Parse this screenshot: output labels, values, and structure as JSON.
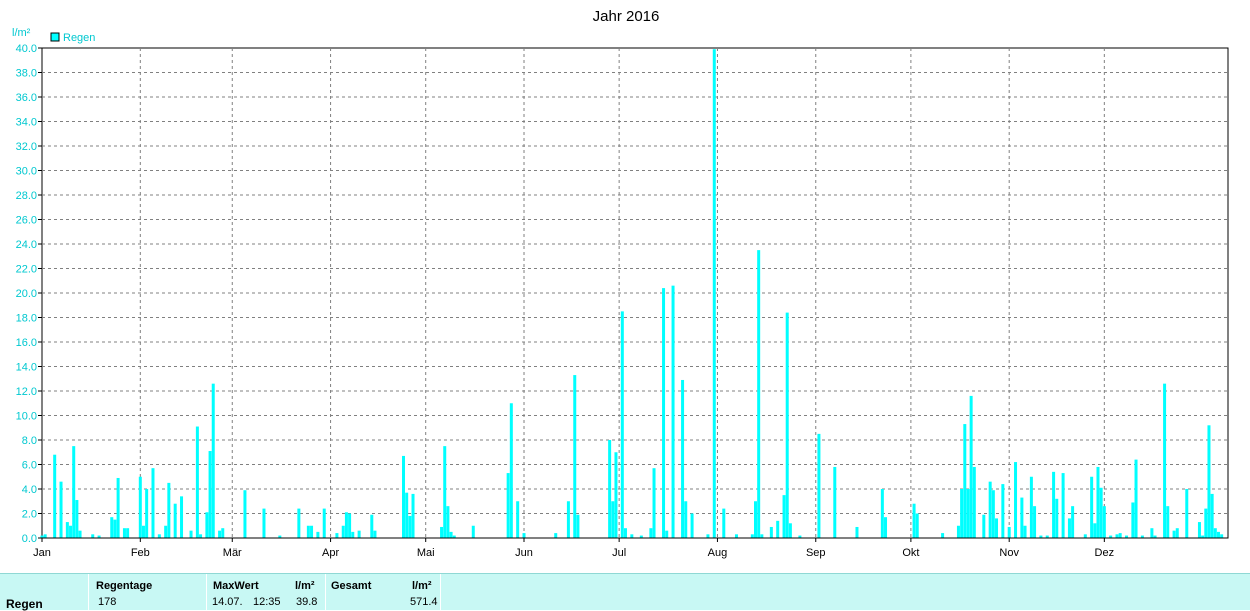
{
  "chart_data": {
    "type": "bar",
    "title": "Jahr 2016",
    "ylabel": "l/m²",
    "ylim": [
      0,
      40
    ],
    "ytick_labels": [
      "0.0",
      "2.0",
      "4.0",
      "6.0",
      "8.0",
      "10.0",
      "12.0",
      "14.0",
      "16.0",
      "18.0",
      "20.0",
      "22.0",
      "24.0",
      "26.0",
      "28.0",
      "30.0",
      "32.0",
      "34.0",
      "36.0",
      "38.0",
      "40.0"
    ],
    "x_tick_labels": [
      "Jan",
      "Feb",
      "Mär",
      "Apr",
      "Mai",
      "Jun",
      "Jul",
      "Aug",
      "Sep",
      "Okt",
      "Nov",
      "Dez"
    ],
    "grid": true,
    "legend": {
      "position": "top-left",
      "entries": [
        "Regen"
      ]
    },
    "color": "#00ffff",
    "series": [
      {
        "name": "Regen",
        "points": [
          [
            1,
            0.2
          ],
          [
            2,
            0.3
          ],
          [
            5,
            6.8
          ],
          [
            7,
            4.6
          ],
          [
            9,
            1.3
          ],
          [
            10,
            1.0
          ],
          [
            11,
            7.5
          ],
          [
            12,
            3.1
          ],
          [
            13,
            0.6
          ],
          [
            17,
            0.3
          ],
          [
            19,
            0.2
          ],
          [
            23,
            1.7
          ],
          [
            24,
            1.5
          ],
          [
            25,
            4.9
          ],
          [
            27,
            0.8
          ],
          [
            28,
            0.8
          ],
          [
            32,
            5.0
          ],
          [
            33,
            1.0
          ],
          [
            34,
            4.0
          ],
          [
            36,
            5.7
          ],
          [
            38,
            0.3
          ],
          [
            40,
            1.0
          ],
          [
            41,
            4.5
          ],
          [
            43,
            2.8
          ],
          [
            45,
            3.4
          ],
          [
            48,
            0.6
          ],
          [
            50,
            9.1
          ],
          [
            51,
            0.3
          ],
          [
            53,
            2.1
          ],
          [
            54,
            7.1
          ],
          [
            55,
            12.6
          ],
          [
            57,
            0.6
          ],
          [
            58,
            0.8
          ],
          [
            65,
            3.9
          ],
          [
            71,
            2.4
          ],
          [
            76,
            0.2
          ],
          [
            82,
            2.4
          ],
          [
            85,
            1.0
          ],
          [
            86,
            1.0
          ],
          [
            88,
            0.5
          ],
          [
            90,
            2.4
          ],
          [
            94,
            0.4
          ],
          [
            96,
            1.0
          ],
          [
            97,
            2.1
          ],
          [
            98,
            2.0
          ],
          [
            99,
            0.5
          ],
          [
            101,
            0.6
          ],
          [
            105,
            1.9
          ],
          [
            106,
            0.6
          ],
          [
            115,
            6.7
          ],
          [
            116,
            3.7
          ],
          [
            117,
            1.8
          ],
          [
            118,
            3.6
          ],
          [
            127,
            0.9
          ],
          [
            128,
            7.5
          ],
          [
            129,
            2.6
          ],
          [
            130,
            0.5
          ],
          [
            131,
            0.2
          ],
          [
            137,
            1.0
          ],
          [
            148,
            5.3
          ],
          [
            149,
            11.0
          ],
          [
            151,
            3.0
          ],
          [
            153,
            0.4
          ],
          [
            163,
            0.4
          ],
          [
            167,
            3.0
          ],
          [
            169,
            13.3
          ],
          [
            170,
            1.9
          ],
          [
            180,
            8.0
          ],
          [
            181,
            3.0
          ],
          [
            182,
            7.0
          ],
          [
            184,
            18.5
          ],
          [
            185,
            0.8
          ],
          [
            187,
            0.3
          ],
          [
            190,
            0.2
          ],
          [
            193,
            0.8
          ],
          [
            194,
            5.7
          ],
          [
            197,
            20.4
          ],
          [
            198,
            0.6
          ],
          [
            200,
            20.6
          ],
          [
            203,
            12.9
          ],
          [
            204,
            3.0
          ],
          [
            206,
            2.0
          ],
          [
            211,
            0.3
          ],
          [
            213,
            39.9
          ],
          [
            216,
            2.4
          ],
          [
            220,
            0.3
          ],
          [
            225,
            0.3
          ],
          [
            226,
            3.0
          ],
          [
            227,
            23.5
          ],
          [
            228,
            0.3
          ],
          [
            231,
            0.9
          ],
          [
            233,
            1.4
          ],
          [
            235,
            3.5
          ],
          [
            236,
            18.4
          ],
          [
            237,
            1.2
          ],
          [
            240,
            0.2
          ],
          [
            246,
            8.5
          ],
          [
            251,
            5.8
          ],
          [
            258,
            0.9
          ],
          [
            266,
            4.0
          ],
          [
            267,
            1.7
          ],
          [
            276,
            2.8
          ],
          [
            277,
            2.0
          ],
          [
            285,
            0.4
          ],
          [
            290,
            1.0
          ],
          [
            291,
            4.0
          ],
          [
            292,
            9.3
          ],
          [
            293,
            4.0
          ],
          [
            294,
            11.6
          ],
          [
            295,
            5.8
          ],
          [
            298,
            1.9
          ],
          [
            300,
            4.6
          ],
          [
            301,
            3.9
          ],
          [
            302,
            1.6
          ],
          [
            304,
            4.4
          ],
          [
            306,
            0.9
          ],
          [
            308,
            6.2
          ],
          [
            310,
            3.3
          ],
          [
            311,
            1.0
          ],
          [
            313,
            5.0
          ],
          [
            314,
            2.6
          ],
          [
            316,
            0.2
          ],
          [
            318,
            0.2
          ],
          [
            320,
            5.4
          ],
          [
            321,
            3.2
          ],
          [
            323,
            5.3
          ],
          [
            325,
            1.6
          ],
          [
            326,
            2.6
          ],
          [
            330,
            0.3
          ],
          [
            332,
            5.0
          ],
          [
            333,
            1.2
          ],
          [
            334,
            5.8
          ],
          [
            335,
            4.1
          ],
          [
            336,
            2.6
          ],
          [
            338,
            0.2
          ],
          [
            340,
            0.3
          ],
          [
            341,
            0.4
          ],
          [
            343,
            0.2
          ],
          [
            345,
            2.9
          ],
          [
            346,
            6.4
          ],
          [
            348,
            0.2
          ],
          [
            351,
            0.8
          ],
          [
            352,
            0.2
          ],
          [
            355,
            12.6
          ],
          [
            356,
            2.6
          ],
          [
            358,
            0.6
          ],
          [
            359,
            0.8
          ],
          [
            362,
            4.0
          ],
          [
            366,
            1.3
          ],
          [
            367,
            0.2
          ],
          [
            368,
            2.4
          ],
          [
            369,
            9.2
          ],
          [
            370,
            3.6
          ],
          [
            371,
            0.8
          ],
          [
            372,
            0.5
          ],
          [
            373,
            0.3
          ]
        ]
      }
    ]
  },
  "stats_table": {
    "row_label": "Regen",
    "headers": {
      "regentage": "Regentage",
      "maxwert": "MaxWert",
      "unit1": "l/m²",
      "gesamt": "Gesamt",
      "unit2": "l/m²"
    },
    "values": {
      "regentage": "178",
      "max_date": "14.07.",
      "max_time": "12:35",
      "max_value": "39.8",
      "gesamt": "571.4"
    }
  }
}
